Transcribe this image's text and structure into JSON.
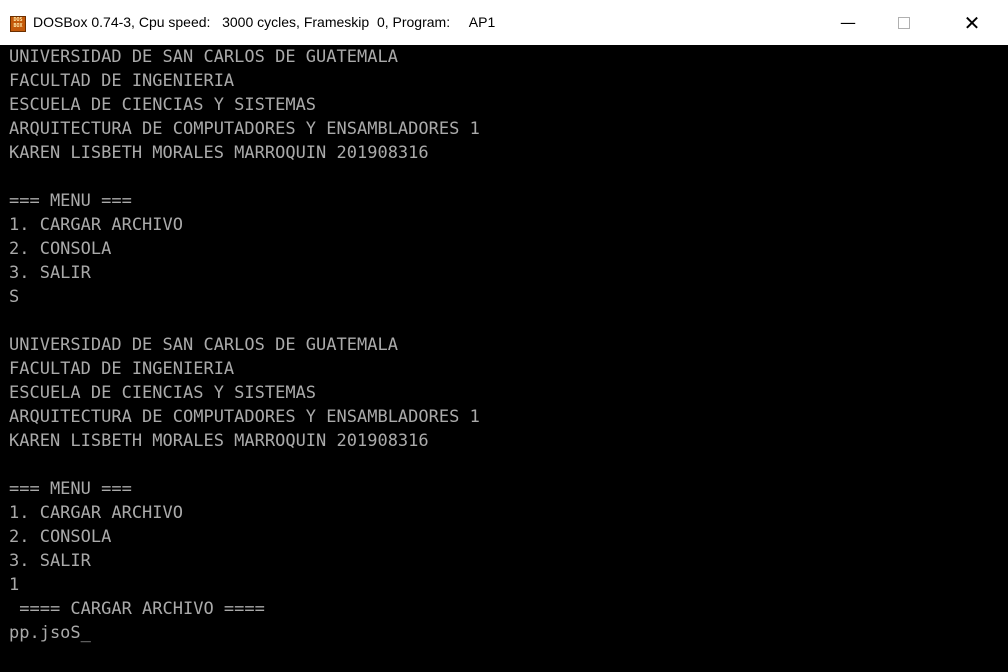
{
  "window": {
    "icon_lines": [
      "DOS",
      "BOX"
    ],
    "title": {
      "app": "DOSBox 0.74-3, Cpu speed:",
      "cycles": "3000 cycles, Frameskip  0, Program:",
      "program": "AP1"
    },
    "buttons": {
      "minimize": "—",
      "close": "✕"
    }
  },
  "console": {
    "text_color": "#aaaaaa",
    "background": "#000000",
    "lines": [
      "UNIVERSIDAD DE SAN CARLOS DE GUATEMALA",
      "FACULTAD DE INGENIERIA",
      "ESCUELA DE CIENCIAS Y SISTEMAS",
      "ARQUITECTURA DE COMPUTADORES Y ENSAMBLADORES 1",
      "KAREN LISBETH MORALES MARROQUIN 201908316",
      "",
      "=== MENU ===",
      "1. CARGAR ARCHIVO",
      "2. CONSOLA",
      "3. SALIR",
      "S",
      "",
      "UNIVERSIDAD DE SAN CARLOS DE GUATEMALA",
      "FACULTAD DE INGENIERIA",
      "ESCUELA DE CIENCIAS Y SISTEMAS",
      "ARQUITECTURA DE COMPUTADORES Y ENSAMBLADORES 1",
      "KAREN LISBETH MORALES MARROQUIN 201908316",
      "",
      "=== MENU ===",
      "1. CARGAR ARCHIVO",
      "2. CONSOLA",
      "3. SALIR",
      "1",
      " ==== CARGAR ARCHIVO ====",
      "pp.jsoS_"
    ]
  }
}
